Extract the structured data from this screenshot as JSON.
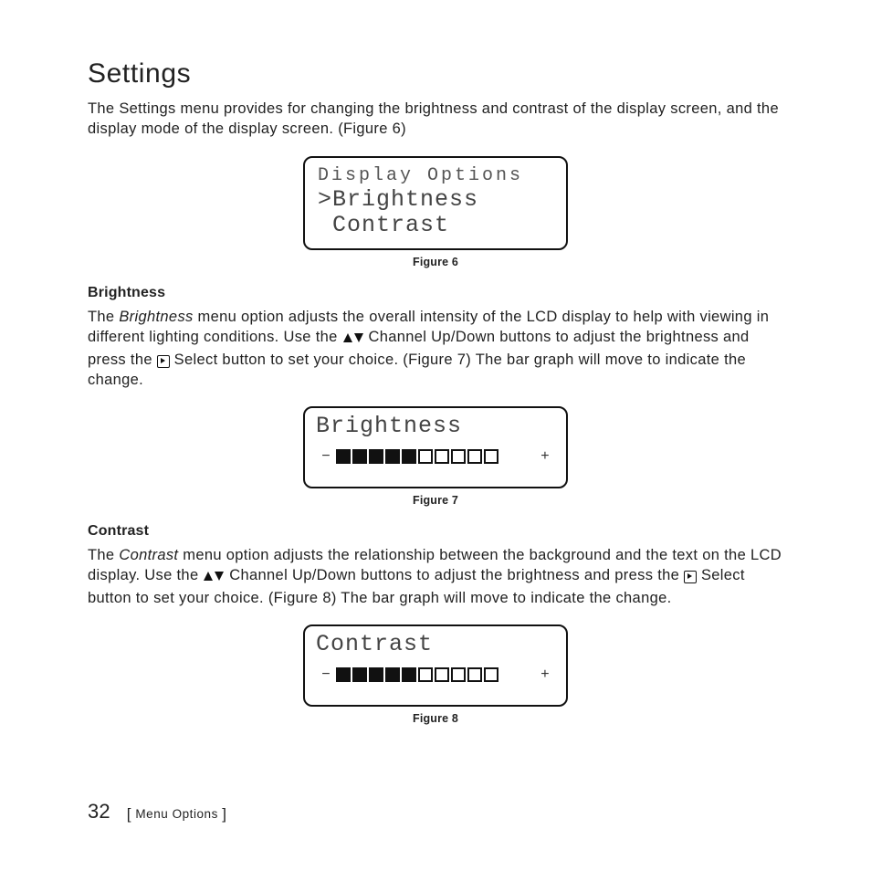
{
  "page_number": "32",
  "footer_section": "Menu Options",
  "heading": "Settings",
  "intro_text": "The Settings menu provides for changing the brightness and contrast of the display screen, and the display mode of the display screen. (Figure 6)",
  "figure6": {
    "caption": "Figure 6",
    "line1": "Display Options",
    "line2": ">Brightness",
    "line3": " Contrast"
  },
  "brightness": {
    "subheading": "Brightness",
    "term": "Brightness",
    "text_before_term": "The ",
    "text_after_term_1": " menu option adjusts the overall intensity of the LCD display to help with viewing in different lighting conditions. Use the ",
    "text_after_icons_1": " Channel Up/Down buttons to adjust the brightness and press the ",
    "text_after_select": " Select button to set your choice. (Figure 7) The bar graph will move to indicate the change."
  },
  "figure7": {
    "caption": "Figure 7",
    "title": "Brightness",
    "filled": 5,
    "total": 10,
    "minus": "−",
    "plus": "+"
  },
  "contrast": {
    "subheading": "Contrast",
    "term": "Contrast",
    "text_before_term": "The ",
    "text_after_term_1": " menu option adjusts the relationship between the background and the text on the LCD display. Use the ",
    "text_after_icons_1": " Channel Up/Down buttons to adjust the brightness and press the ",
    "text_after_select": " Select button to set your choice. (Figure 8) The bar graph will move to indicate the change."
  },
  "figure8": {
    "caption": "Figure 8",
    "title": "Contrast",
    "filled": 5,
    "total": 10,
    "minus": "−",
    "plus": "+"
  }
}
